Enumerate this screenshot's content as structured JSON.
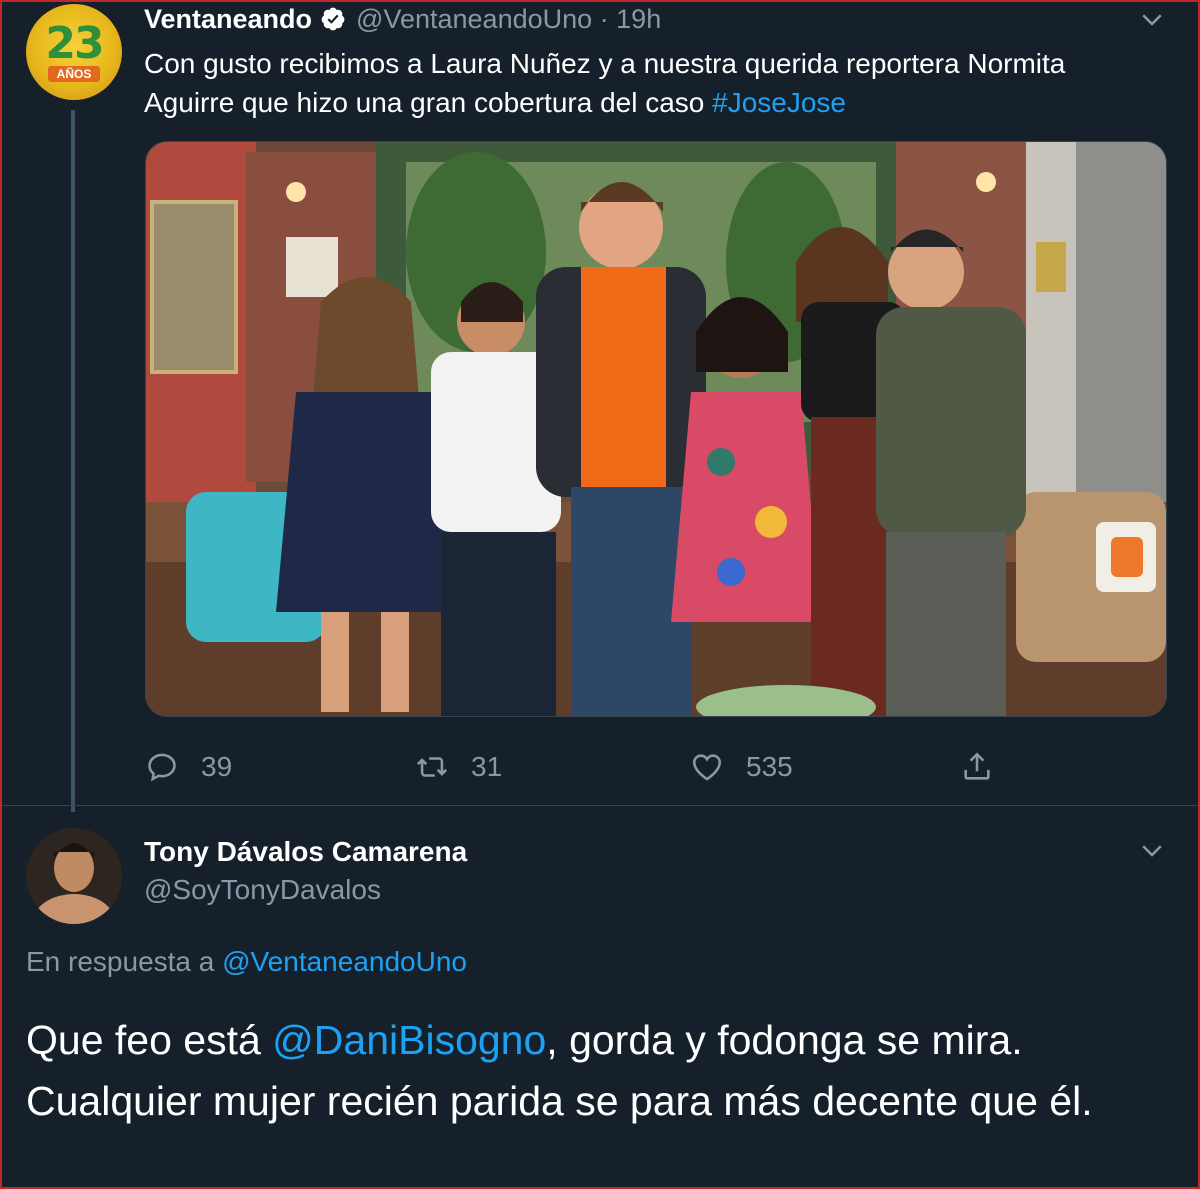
{
  "tweet": {
    "author_name": "Ventaneando",
    "author_handle": "@VentaneandoUno",
    "separator": " · ",
    "time": "19h",
    "avatar_number": "23",
    "avatar_text": "AÑOS",
    "text_before_link": "Con gusto recibimos a Laura Nuñez y a nuestra querida reportera Normita Aguirre que hizo una gran cobertura del caso ",
    "hashtag": "#JoseJose",
    "stats": {
      "replies": "39",
      "retweets": "31",
      "likes": "535"
    },
    "icons": {
      "verified": "verified-badge-icon",
      "more": "chevron-down-icon",
      "reply": "reply-icon",
      "retweet": "retweet-icon",
      "like": "heart-icon",
      "share": "share-icon"
    }
  },
  "reply": {
    "author_name": "Tony Dávalos Camarena",
    "author_handle": "@SoyTonyDavalos",
    "replying_label": "En respuesta a ",
    "replying_to": "@VentaneandoUno",
    "text_before_mention": "Que feo está ",
    "mention": "@DaniBisogno",
    "text_after_mention": ", gorda y fodonga se mira. Cualquier mujer recién parida se para más decente que él."
  },
  "colors": {
    "background": "#15202b",
    "link": "#1da1f2",
    "secondary_text": "#8899a6",
    "border": "#c0282d"
  }
}
